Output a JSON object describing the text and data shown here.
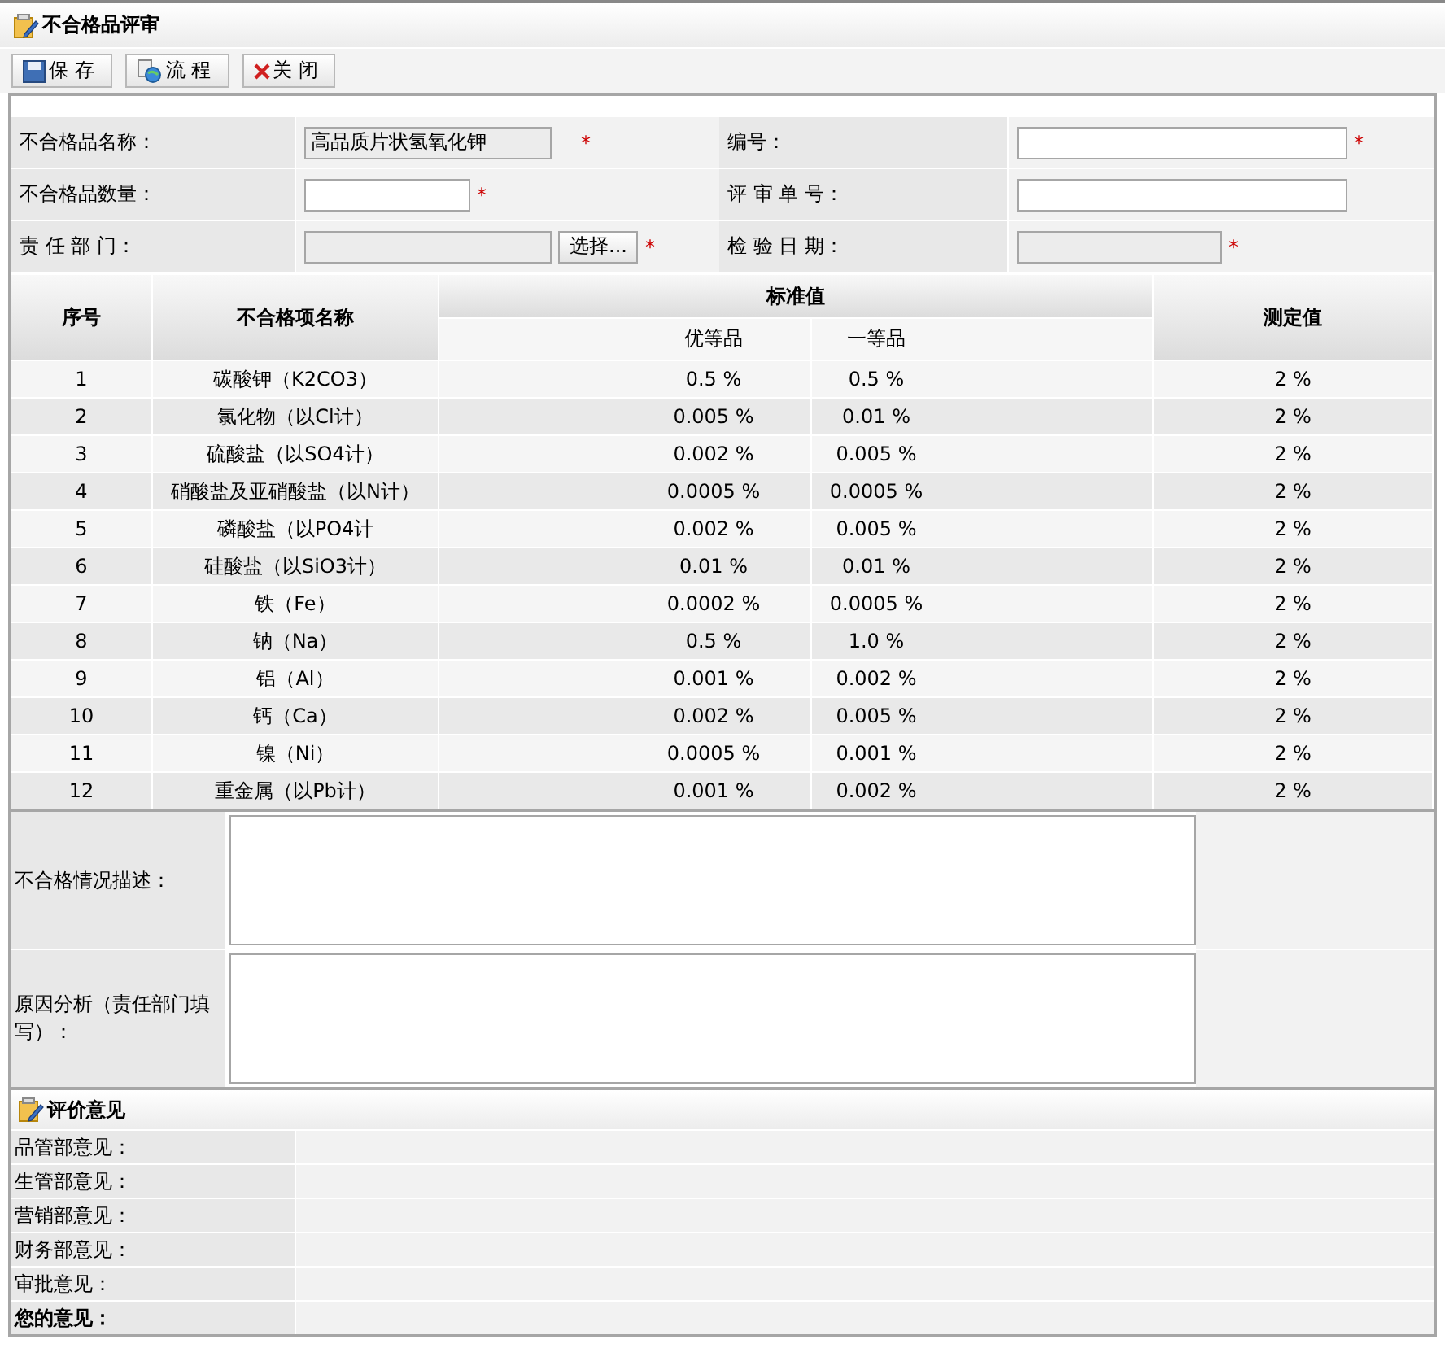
{
  "window": {
    "title": "不合格品评审"
  },
  "toolbar": [
    {
      "kind": "save",
      "label": "保 存"
    },
    {
      "kind": "flow",
      "label": "流 程"
    },
    {
      "kind": "close",
      "label": "关 闭"
    }
  ],
  "form": [
    {
      "label": "不合格品名称：",
      "value": "高品质片状氢氧化钾",
      "kind": "medium",
      "disabled": true,
      "required_mark": "*"
    },
    {
      "label": "编号：",
      "kind": "large",
      "disabled": false,
      "required_mark": "*"
    },
    {
      "label": "不合格品数量：",
      "kind": "small",
      "disabled": false,
      "required_mark": "*"
    },
    {
      "label": "评 审 单 号：",
      "kind": "large",
      "disabled": false
    },
    {
      "label": "责 任 部 门：",
      "kind": "medium",
      "disabled": true,
      "required_mark": "*",
      "button": "选择..."
    },
    {
      "label": "检 验 日 期：",
      "kind": "date",
      "disabled": true,
      "required_mark": "*"
    }
  ],
  "table": {
    "group_header": "标准值",
    "columns": [
      "序号",
      "不合格项名称",
      "优等品",
      "一等品",
      "测定值"
    ],
    "rows": [
      [
        "1",
        "碳酸钾（K2CO3）",
        "0.5 %",
        "0.5 %",
        "2 %"
      ],
      [
        "2",
        "氯化物（以Cl计）",
        "0.005 %",
        "0.01 %",
        "2 %"
      ],
      [
        "3",
        "硫酸盐（以SO4计）",
        "0.002 %",
        "0.005 %",
        "2 %"
      ],
      [
        "4",
        "硝酸盐及亚硝酸盐（以N计）",
        "0.0005 %",
        "0.0005 %",
        "2 %"
      ],
      [
        "5",
        "磷酸盐（以PO4计",
        "0.002 %",
        "0.005 %",
        "2 %"
      ],
      [
        "6",
        "硅酸盐（以SiO3计）",
        "0.01 %",
        "0.01 %",
        "2 %"
      ],
      [
        "7",
        "铁（Fe）",
        "0.0002 %",
        "0.0005 %",
        "2 %"
      ],
      [
        "8",
        "钠（Na）",
        "0.5 %",
        "1.0 %",
        "2 %"
      ],
      [
        "9",
        "铝（Al）",
        "0.001 %",
        "0.002 %",
        "2 %"
      ],
      [
        "10",
        "钙（Ca）",
        "0.002 %",
        "0.005 %",
        "2 %"
      ],
      [
        "11",
        "镍（Ni）",
        "0.0005 %",
        "0.001 %",
        "2 %"
      ],
      [
        "12",
        "重金属（以Pb计）",
        "0.001 %",
        "0.002 %",
        "2 %"
      ]
    ]
  },
  "descriptions": [
    {
      "label": "不合格情况描述："
    },
    {
      "label": "原因分析（责任部门填写）："
    }
  ],
  "opinions": {
    "title": "评价意见",
    "items": [
      {
        "label": "品管部意见：",
        "emphasized": false
      },
      {
        "label": "生管部意见：",
        "emphasized": false
      },
      {
        "label": "营销部意见：",
        "emphasized": false
      },
      {
        "label": "财务部意见：",
        "emphasized": false
      },
      {
        "label": "审批意见：",
        "emphasized": false
      },
      {
        "label": "您的意见：",
        "emphasized": true
      }
    ]
  }
}
